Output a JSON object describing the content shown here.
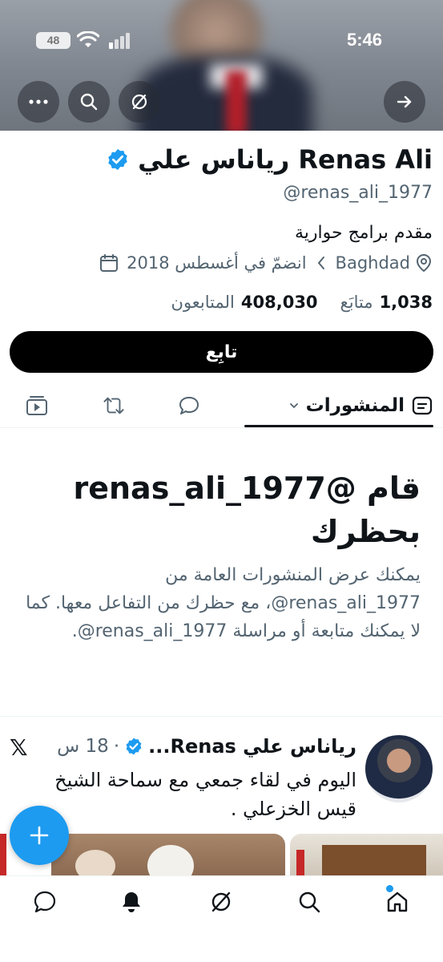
{
  "status_bar": {
    "time": "5:46",
    "battery": "48"
  },
  "profile": {
    "name": "رياناس علي Renas Ali",
    "handle": "@renas_ali_1977",
    "bio": "مقدم برامج حوارية",
    "location": "Baghdad",
    "joined": "انضمّ في أغسطس 2018",
    "following_count": "1,038",
    "following_label": "متابَع",
    "followers_count": "408,030",
    "followers_label": "المتابعون",
    "follow_button": "تابِع"
  },
  "tabs": {
    "active_label": "المنشورات"
  },
  "blocked": {
    "title": "قام @renas_ali_1977 بحظرك",
    "body": "يمكنك عرض المنشورات العامة من ‎@renas_ali_1977‏، مع حظرك من التفاعل معها. كما لا يمكنك متابعة أو مراسلة ‎@renas_ali_1977‏."
  },
  "post": {
    "author": "رياناس علي Renas...",
    "time": "18 س",
    "separator": "·",
    "text": "اليوم في لقاء جمعي مع سماحة الشيخ قيس الخزعلي ."
  },
  "x_logo": "𝕏",
  "colors": {
    "accent": "#1d9bf0",
    "text": "#0f1419",
    "muted": "#536471"
  }
}
